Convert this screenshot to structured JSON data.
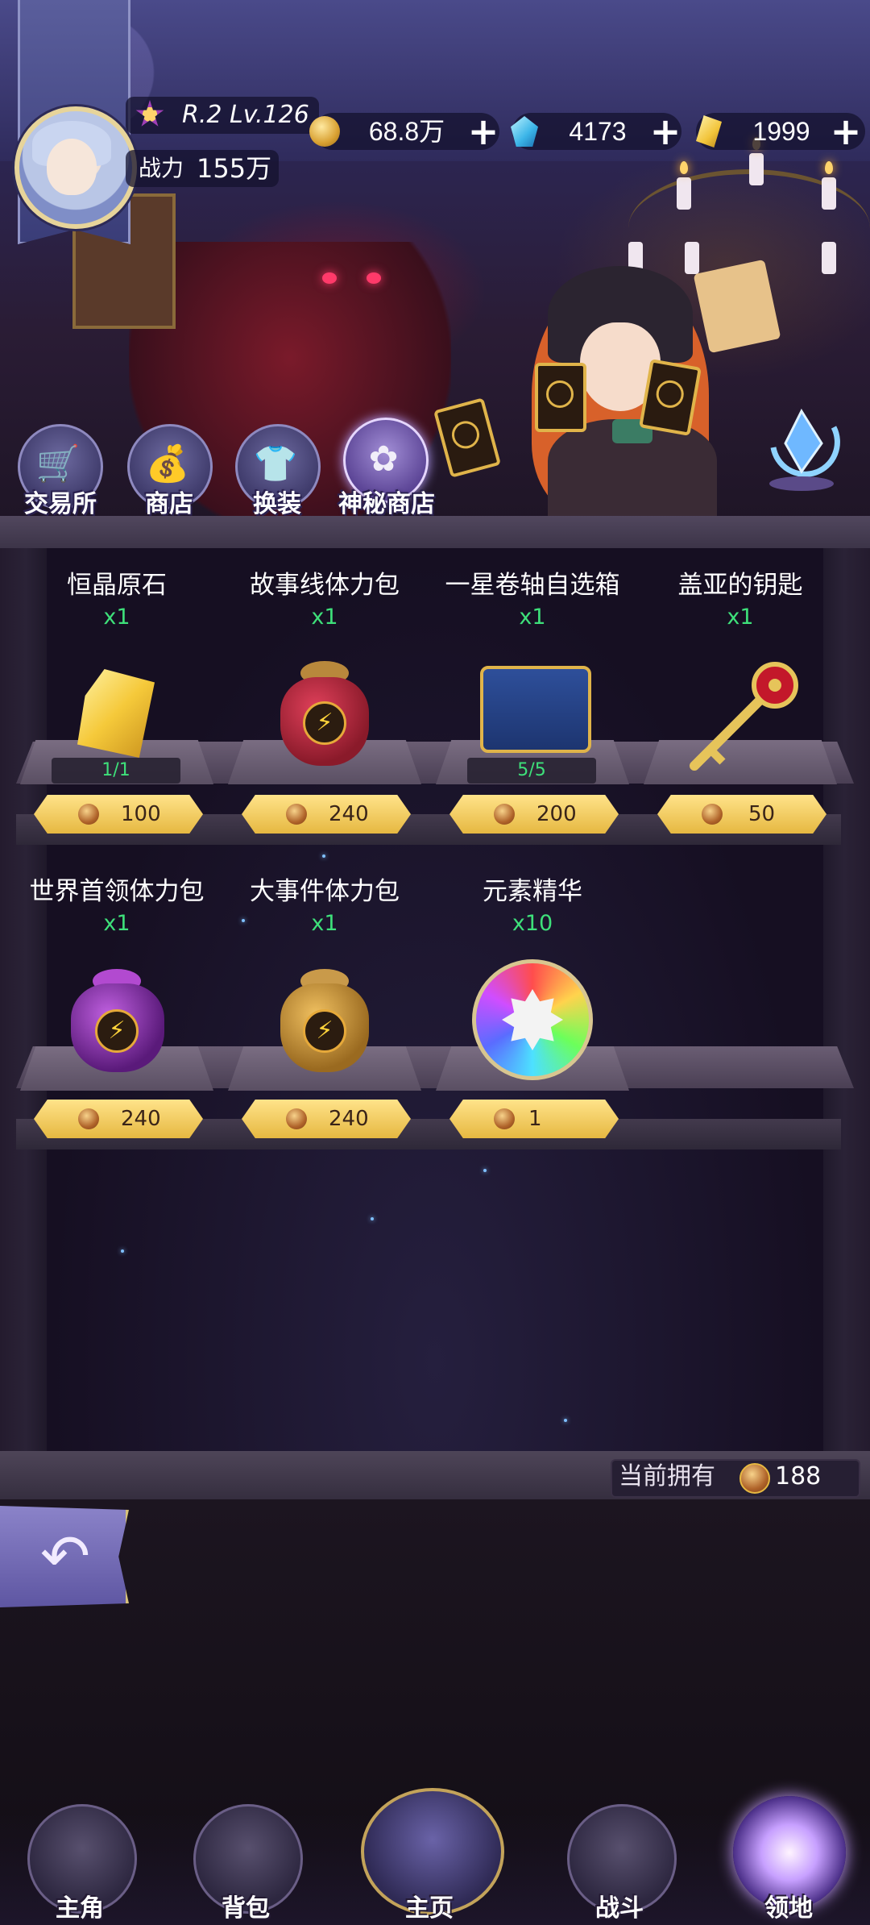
{
  "player": {
    "rank_level": "R.2 Lv.126",
    "power_label": "战力",
    "power_value": "155万"
  },
  "resources": [
    {
      "icon": "gold-coin-icon",
      "value": "68.8万",
      "add": "+"
    },
    {
      "icon": "blue-crystal-icon",
      "value": "4173",
      "add": "+"
    },
    {
      "icon": "gold-crystal-icon",
      "value": "1999",
      "add": "+"
    }
  ],
  "tabs": [
    {
      "label": "交易所",
      "icon": "cart-icon",
      "glyph": "🛒"
    },
    {
      "label": "商店",
      "icon": "money-bag-icon",
      "glyph": "💰"
    },
    {
      "label": "换装",
      "icon": "shirt-icon",
      "glyph": "👕"
    },
    {
      "label": "神秘商店",
      "icon": "mystery-bag-icon",
      "glyph": "✿"
    }
  ],
  "shop_items": [
    {
      "name": "恒晶原石",
      "qty": "x1",
      "price": "100",
      "stock": "1/1",
      "icon": "yellow-crystal-icon"
    },
    {
      "name": "故事线体力包",
      "qty": "x1",
      "price": "240",
      "stock": "",
      "icon": "red-energy-bag-icon"
    },
    {
      "name": "一星卷轴自选箱",
      "qty": "x1",
      "price": "200",
      "stock": "5/5",
      "icon": "scroll-chest-icon"
    },
    {
      "name": "盖亚的钥匙",
      "qty": "x1",
      "price": "50",
      "stock": "",
      "icon": "gaia-key-icon"
    },
    {
      "name": "世界首领体力包",
      "qty": "x1",
      "price": "240",
      "stock": "",
      "icon": "purple-energy-bag-icon"
    },
    {
      "name": "大事件体力包",
      "qty": "x1",
      "price": "240",
      "stock": "",
      "icon": "gold-energy-bag-icon"
    },
    {
      "name": "元素精华",
      "qty": "x10",
      "price": "1",
      "stock": "",
      "icon": "element-essence-icon"
    }
  ],
  "owned": {
    "label": "当前拥有",
    "value": "188"
  },
  "bolt_glyph": "⚡",
  "back_glyph": "↶",
  "nav": [
    {
      "label": "主角",
      "icon": "hero-icon"
    },
    {
      "label": "背包",
      "icon": "backpack-icon"
    },
    {
      "label": "主页",
      "icon": "home-book-icon"
    },
    {
      "label": "战斗",
      "icon": "battle-swords-icon"
    },
    {
      "label": "领地",
      "icon": "territory-icon"
    }
  ],
  "colors": {
    "qty_green": "#3ee07a",
    "price_gold": "#e6b841",
    "active_tab": "#a28ed6"
  }
}
